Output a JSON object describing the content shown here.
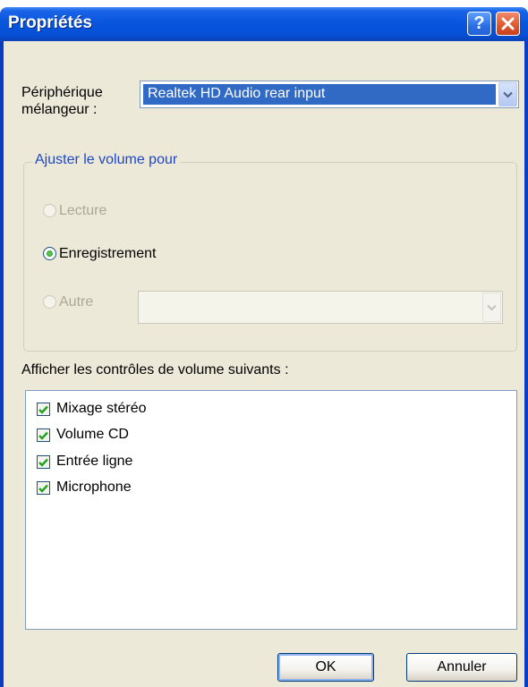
{
  "window": {
    "title": "Propriétés"
  },
  "titlebar": {
    "help_label": "?",
    "help_icon": "help-question-icon",
    "close_icon": "close-x-icon"
  },
  "mixer": {
    "label_line1": "Périphérique",
    "label_line2": "mélangeur :",
    "selected_value": "Realtek HD Audio rear input"
  },
  "volume_group": {
    "title": "Ajuster le volume pour",
    "options": [
      {
        "label": "Lecture",
        "selected": false,
        "enabled": false
      },
      {
        "label": "Enregistrement",
        "selected": true,
        "enabled": true
      },
      {
        "label": "Autre",
        "selected": false,
        "enabled": false
      }
    ],
    "autre_value": ""
  },
  "controls": {
    "heading": "Afficher les contrôles de volume suivants :",
    "items": [
      {
        "label": "Mixage stéréo",
        "checked": true
      },
      {
        "label": "Volume CD",
        "checked": true
      },
      {
        "label": "Entrée ligne",
        "checked": true
      },
      {
        "label": "Microphone",
        "checked": true
      }
    ]
  },
  "buttons": {
    "ok": "OK",
    "cancel": "Annuler"
  },
  "colors": {
    "titlebar": "#0856dd",
    "client": "#ece9d8",
    "selection": "#316ac5",
    "group_title": "#1f48c6"
  }
}
